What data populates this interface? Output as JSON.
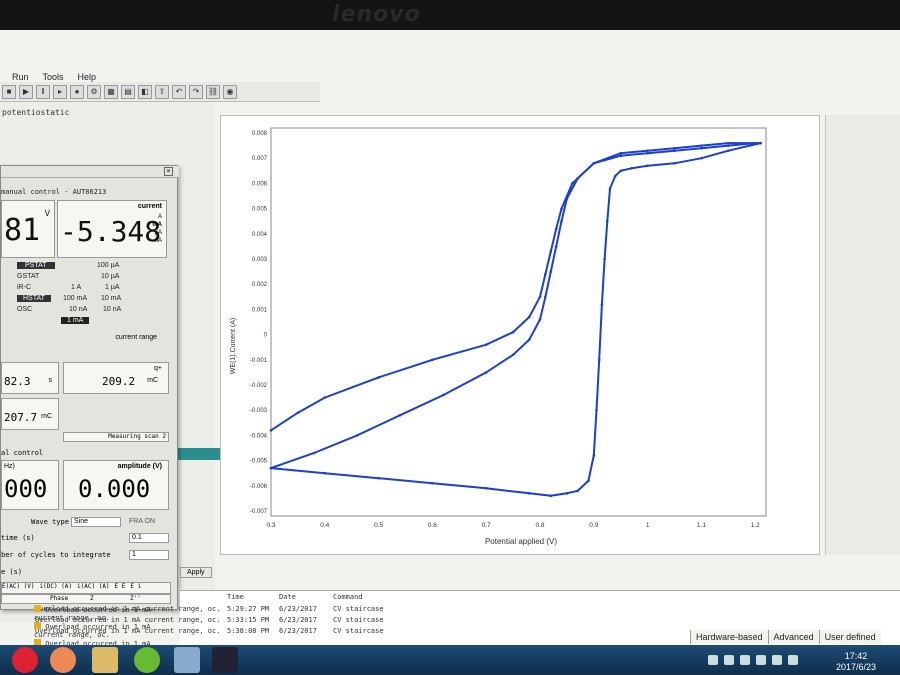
{
  "monitor": {
    "brand": "lenovo"
  },
  "menu": {
    "items": [
      "Run",
      "Tools",
      "Help"
    ]
  },
  "tree": {
    "label": "potentiostatic"
  },
  "panel": {
    "title": "manual control - AUT86213",
    "potential_display": "81",
    "potential_unit": "V",
    "current_display": "-5.348",
    "current_label": "current",
    "current_units": [
      "A",
      "mA",
      "µA",
      "nA"
    ],
    "modes": [
      "PSTAT",
      "GSTAT",
      "iR-C",
      "HSTAT",
      "OSC"
    ],
    "mode_col2": [
      "100 µA",
      "10 µA",
      "1 A",
      "1 µA",
      "100 mA",
      "10 mA",
      "10 nA",
      "10 nA"
    ],
    "range_selected": "1 mA",
    "current_range_label": "current range",
    "charge_value": "82.3",
    "charge_unit": "s",
    "q_label": "q+",
    "q_value": "209.2",
    "q_unit": "mC",
    "q2_value": "207.7",
    "q2_unit": "mC",
    "measuring_label": "Measuring scan 2",
    "signal_control": "al control",
    "freq_label": "Hz)",
    "freq_display": "000",
    "amplitude_label": "amplitude (V)",
    "amplitude_display": "0.000",
    "wave_type_label": "Wave type",
    "wave_type_value": "Sine",
    "fra_label": "FRA ON",
    "time_label": "time (s)",
    "time_value": "0.1",
    "cycles_label": "ber of cycles to integrate",
    "cycles_value": "1",
    "s_label": "e (s)",
    "cols": [
      "E(AC) (V)",
      "i(DC) (A)",
      "i(AC) (A)",
      "E E",
      "E i"
    ],
    "row2": [
      "Phase",
      "Z",
      "Z''"
    ],
    "apply_label": "Apply"
  },
  "log": {
    "headers": [
      "Time",
      "Date",
      "Command"
    ],
    "rows": [
      {
        "msg": "Overload occurred in 1 mA current range, oc.",
        "time": "5:29:27 PM",
        "date": "6/23/2017",
        "cmd": "CV staircase"
      },
      {
        "msg": "Overload occurred in 1 mA current range, oc.",
        "time": "5:33:15 PM",
        "date": "6/23/2017",
        "cmd": "CV staircase"
      },
      {
        "msg": "Overload occurred in 1 mA current range, oc.",
        "time": "5:38:08 PM",
        "date": "6/23/2017",
        "cmd": "CV staircase"
      }
    ]
  },
  "statusbar": [
    "Hardware-based",
    "Advanced",
    "User defined"
  ],
  "clock": {
    "time": "17:42",
    "date": "2017/6/23"
  },
  "chart_data": {
    "type": "line",
    "xlabel": "Potential applied (V)",
    "ylabel": "WE(1).Current (A)",
    "xlim": [
      0.3,
      1.22
    ],
    "ylim": [
      -0.0072,
      0.0082
    ],
    "xticks": [
      "0.3",
      "0.4",
      "0.5",
      "0.6",
      "0.7",
      "0.8",
      "0.9",
      "1",
      "1.1",
      "1.2"
    ],
    "yticks": [
      "0.008",
      "0.007",
      "0.006",
      "0.005",
      "0.004",
      "0.003",
      "0.002",
      "0.001",
      "0",
      "-0.001",
      "-0.002",
      "-0.003",
      "-0.004",
      "-0.005",
      "-0.006",
      "-0.007"
    ],
    "grid": true,
    "series_color": "#1a3fd1",
    "series": [
      {
        "x": [
          0.3,
          0.35,
          0.4,
          0.5,
          0.6,
          0.7,
          0.75,
          0.78,
          0.8,
          0.81,
          0.82,
          0.83,
          0.84,
          0.86,
          0.9,
          0.95,
          1.0,
          1.05,
          1.1,
          1.15,
          1.2,
          1.21
        ],
        "y": [
          -0.0038,
          -0.0031,
          -0.0025,
          -0.0017,
          -0.001,
          -0.0004,
          0.0001,
          0.0007,
          0.0015,
          0.0024,
          0.0033,
          0.0042,
          0.005,
          0.006,
          0.0068,
          0.0072,
          0.0073,
          0.0074,
          0.0075,
          0.0076,
          0.0076,
          0.0076
        ]
      },
      {
        "x": [
          1.21,
          1.15,
          1.1,
          1.05,
          1.0,
          0.97,
          0.95,
          0.94,
          0.93,
          0.925,
          0.92,
          0.915,
          0.91,
          0.905,
          0.9,
          0.89,
          0.87,
          0.85,
          0.82,
          0.78,
          0.7,
          0.6,
          0.5,
          0.4,
          0.3
        ],
        "y": [
          0.0076,
          0.0073,
          0.007,
          0.0068,
          0.0067,
          0.0066,
          0.0065,
          0.0063,
          0.0058,
          0.0045,
          0.003,
          0.0012,
          -0.001,
          -0.003,
          -0.0048,
          -0.0058,
          -0.0062,
          -0.0063,
          -0.0064,
          -0.0063,
          -0.0061,
          -0.0059,
          -0.0057,
          -0.0055,
          -0.0053
        ]
      },
      {
        "x": [
          0.3,
          0.38,
          0.46,
          0.54,
          0.62,
          0.7,
          0.75,
          0.78,
          0.8,
          0.81,
          0.82,
          0.83,
          0.84,
          0.85,
          0.87,
          0.9,
          0.95,
          1.0,
          1.05,
          1.1,
          1.15,
          1.2
        ],
        "y": [
          -0.0053,
          -0.0047,
          -0.004,
          -0.0032,
          -0.0024,
          -0.0015,
          -0.0008,
          -0.0002,
          0.0006,
          0.0015,
          0.0025,
          0.0035,
          0.0045,
          0.0054,
          0.0062,
          0.0068,
          0.0071,
          0.0072,
          0.0073,
          0.0074,
          0.0075,
          0.0076
        ]
      }
    ]
  }
}
